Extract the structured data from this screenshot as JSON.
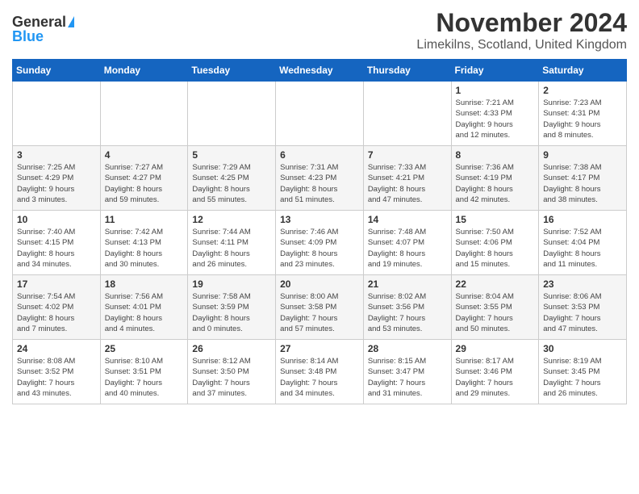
{
  "logo": {
    "general": "General",
    "blue": "Blue"
  },
  "title": "November 2024",
  "location": "Limekilns, Scotland, United Kingdom",
  "days_header": [
    "Sunday",
    "Monday",
    "Tuesday",
    "Wednesday",
    "Thursday",
    "Friday",
    "Saturday"
  ],
  "weeks": [
    [
      {
        "day": "",
        "info": ""
      },
      {
        "day": "",
        "info": ""
      },
      {
        "day": "",
        "info": ""
      },
      {
        "day": "",
        "info": ""
      },
      {
        "day": "",
        "info": ""
      },
      {
        "day": "1",
        "info": "Sunrise: 7:21 AM\nSunset: 4:33 PM\nDaylight: 9 hours\nand 12 minutes."
      },
      {
        "day": "2",
        "info": "Sunrise: 7:23 AM\nSunset: 4:31 PM\nDaylight: 9 hours\nand 8 minutes."
      }
    ],
    [
      {
        "day": "3",
        "info": "Sunrise: 7:25 AM\nSunset: 4:29 PM\nDaylight: 9 hours\nand 3 minutes."
      },
      {
        "day": "4",
        "info": "Sunrise: 7:27 AM\nSunset: 4:27 PM\nDaylight: 8 hours\nand 59 minutes."
      },
      {
        "day": "5",
        "info": "Sunrise: 7:29 AM\nSunset: 4:25 PM\nDaylight: 8 hours\nand 55 minutes."
      },
      {
        "day": "6",
        "info": "Sunrise: 7:31 AM\nSunset: 4:23 PM\nDaylight: 8 hours\nand 51 minutes."
      },
      {
        "day": "7",
        "info": "Sunrise: 7:33 AM\nSunset: 4:21 PM\nDaylight: 8 hours\nand 47 minutes."
      },
      {
        "day": "8",
        "info": "Sunrise: 7:36 AM\nSunset: 4:19 PM\nDaylight: 8 hours\nand 42 minutes."
      },
      {
        "day": "9",
        "info": "Sunrise: 7:38 AM\nSunset: 4:17 PM\nDaylight: 8 hours\nand 38 minutes."
      }
    ],
    [
      {
        "day": "10",
        "info": "Sunrise: 7:40 AM\nSunset: 4:15 PM\nDaylight: 8 hours\nand 34 minutes."
      },
      {
        "day": "11",
        "info": "Sunrise: 7:42 AM\nSunset: 4:13 PM\nDaylight: 8 hours\nand 30 minutes."
      },
      {
        "day": "12",
        "info": "Sunrise: 7:44 AM\nSunset: 4:11 PM\nDaylight: 8 hours\nand 26 minutes."
      },
      {
        "day": "13",
        "info": "Sunrise: 7:46 AM\nSunset: 4:09 PM\nDaylight: 8 hours\nand 23 minutes."
      },
      {
        "day": "14",
        "info": "Sunrise: 7:48 AM\nSunset: 4:07 PM\nDaylight: 8 hours\nand 19 minutes."
      },
      {
        "day": "15",
        "info": "Sunrise: 7:50 AM\nSunset: 4:06 PM\nDaylight: 8 hours\nand 15 minutes."
      },
      {
        "day": "16",
        "info": "Sunrise: 7:52 AM\nSunset: 4:04 PM\nDaylight: 8 hours\nand 11 minutes."
      }
    ],
    [
      {
        "day": "17",
        "info": "Sunrise: 7:54 AM\nSunset: 4:02 PM\nDaylight: 8 hours\nand 7 minutes."
      },
      {
        "day": "18",
        "info": "Sunrise: 7:56 AM\nSunset: 4:01 PM\nDaylight: 8 hours\nand 4 minutes."
      },
      {
        "day": "19",
        "info": "Sunrise: 7:58 AM\nSunset: 3:59 PM\nDaylight: 8 hours\nand 0 minutes."
      },
      {
        "day": "20",
        "info": "Sunrise: 8:00 AM\nSunset: 3:58 PM\nDaylight: 7 hours\nand 57 minutes."
      },
      {
        "day": "21",
        "info": "Sunrise: 8:02 AM\nSunset: 3:56 PM\nDaylight: 7 hours\nand 53 minutes."
      },
      {
        "day": "22",
        "info": "Sunrise: 8:04 AM\nSunset: 3:55 PM\nDaylight: 7 hours\nand 50 minutes."
      },
      {
        "day": "23",
        "info": "Sunrise: 8:06 AM\nSunset: 3:53 PM\nDaylight: 7 hours\nand 47 minutes."
      }
    ],
    [
      {
        "day": "24",
        "info": "Sunrise: 8:08 AM\nSunset: 3:52 PM\nDaylight: 7 hours\nand 43 minutes."
      },
      {
        "day": "25",
        "info": "Sunrise: 8:10 AM\nSunset: 3:51 PM\nDaylight: 7 hours\nand 40 minutes."
      },
      {
        "day": "26",
        "info": "Sunrise: 8:12 AM\nSunset: 3:50 PM\nDaylight: 7 hours\nand 37 minutes."
      },
      {
        "day": "27",
        "info": "Sunrise: 8:14 AM\nSunset: 3:48 PM\nDaylight: 7 hours\nand 34 minutes."
      },
      {
        "day": "28",
        "info": "Sunrise: 8:15 AM\nSunset: 3:47 PM\nDaylight: 7 hours\nand 31 minutes."
      },
      {
        "day": "29",
        "info": "Sunrise: 8:17 AM\nSunset: 3:46 PM\nDaylight: 7 hours\nand 29 minutes."
      },
      {
        "day": "30",
        "info": "Sunrise: 8:19 AM\nSunset: 3:45 PM\nDaylight: 7 hours\nand 26 minutes."
      }
    ]
  ]
}
